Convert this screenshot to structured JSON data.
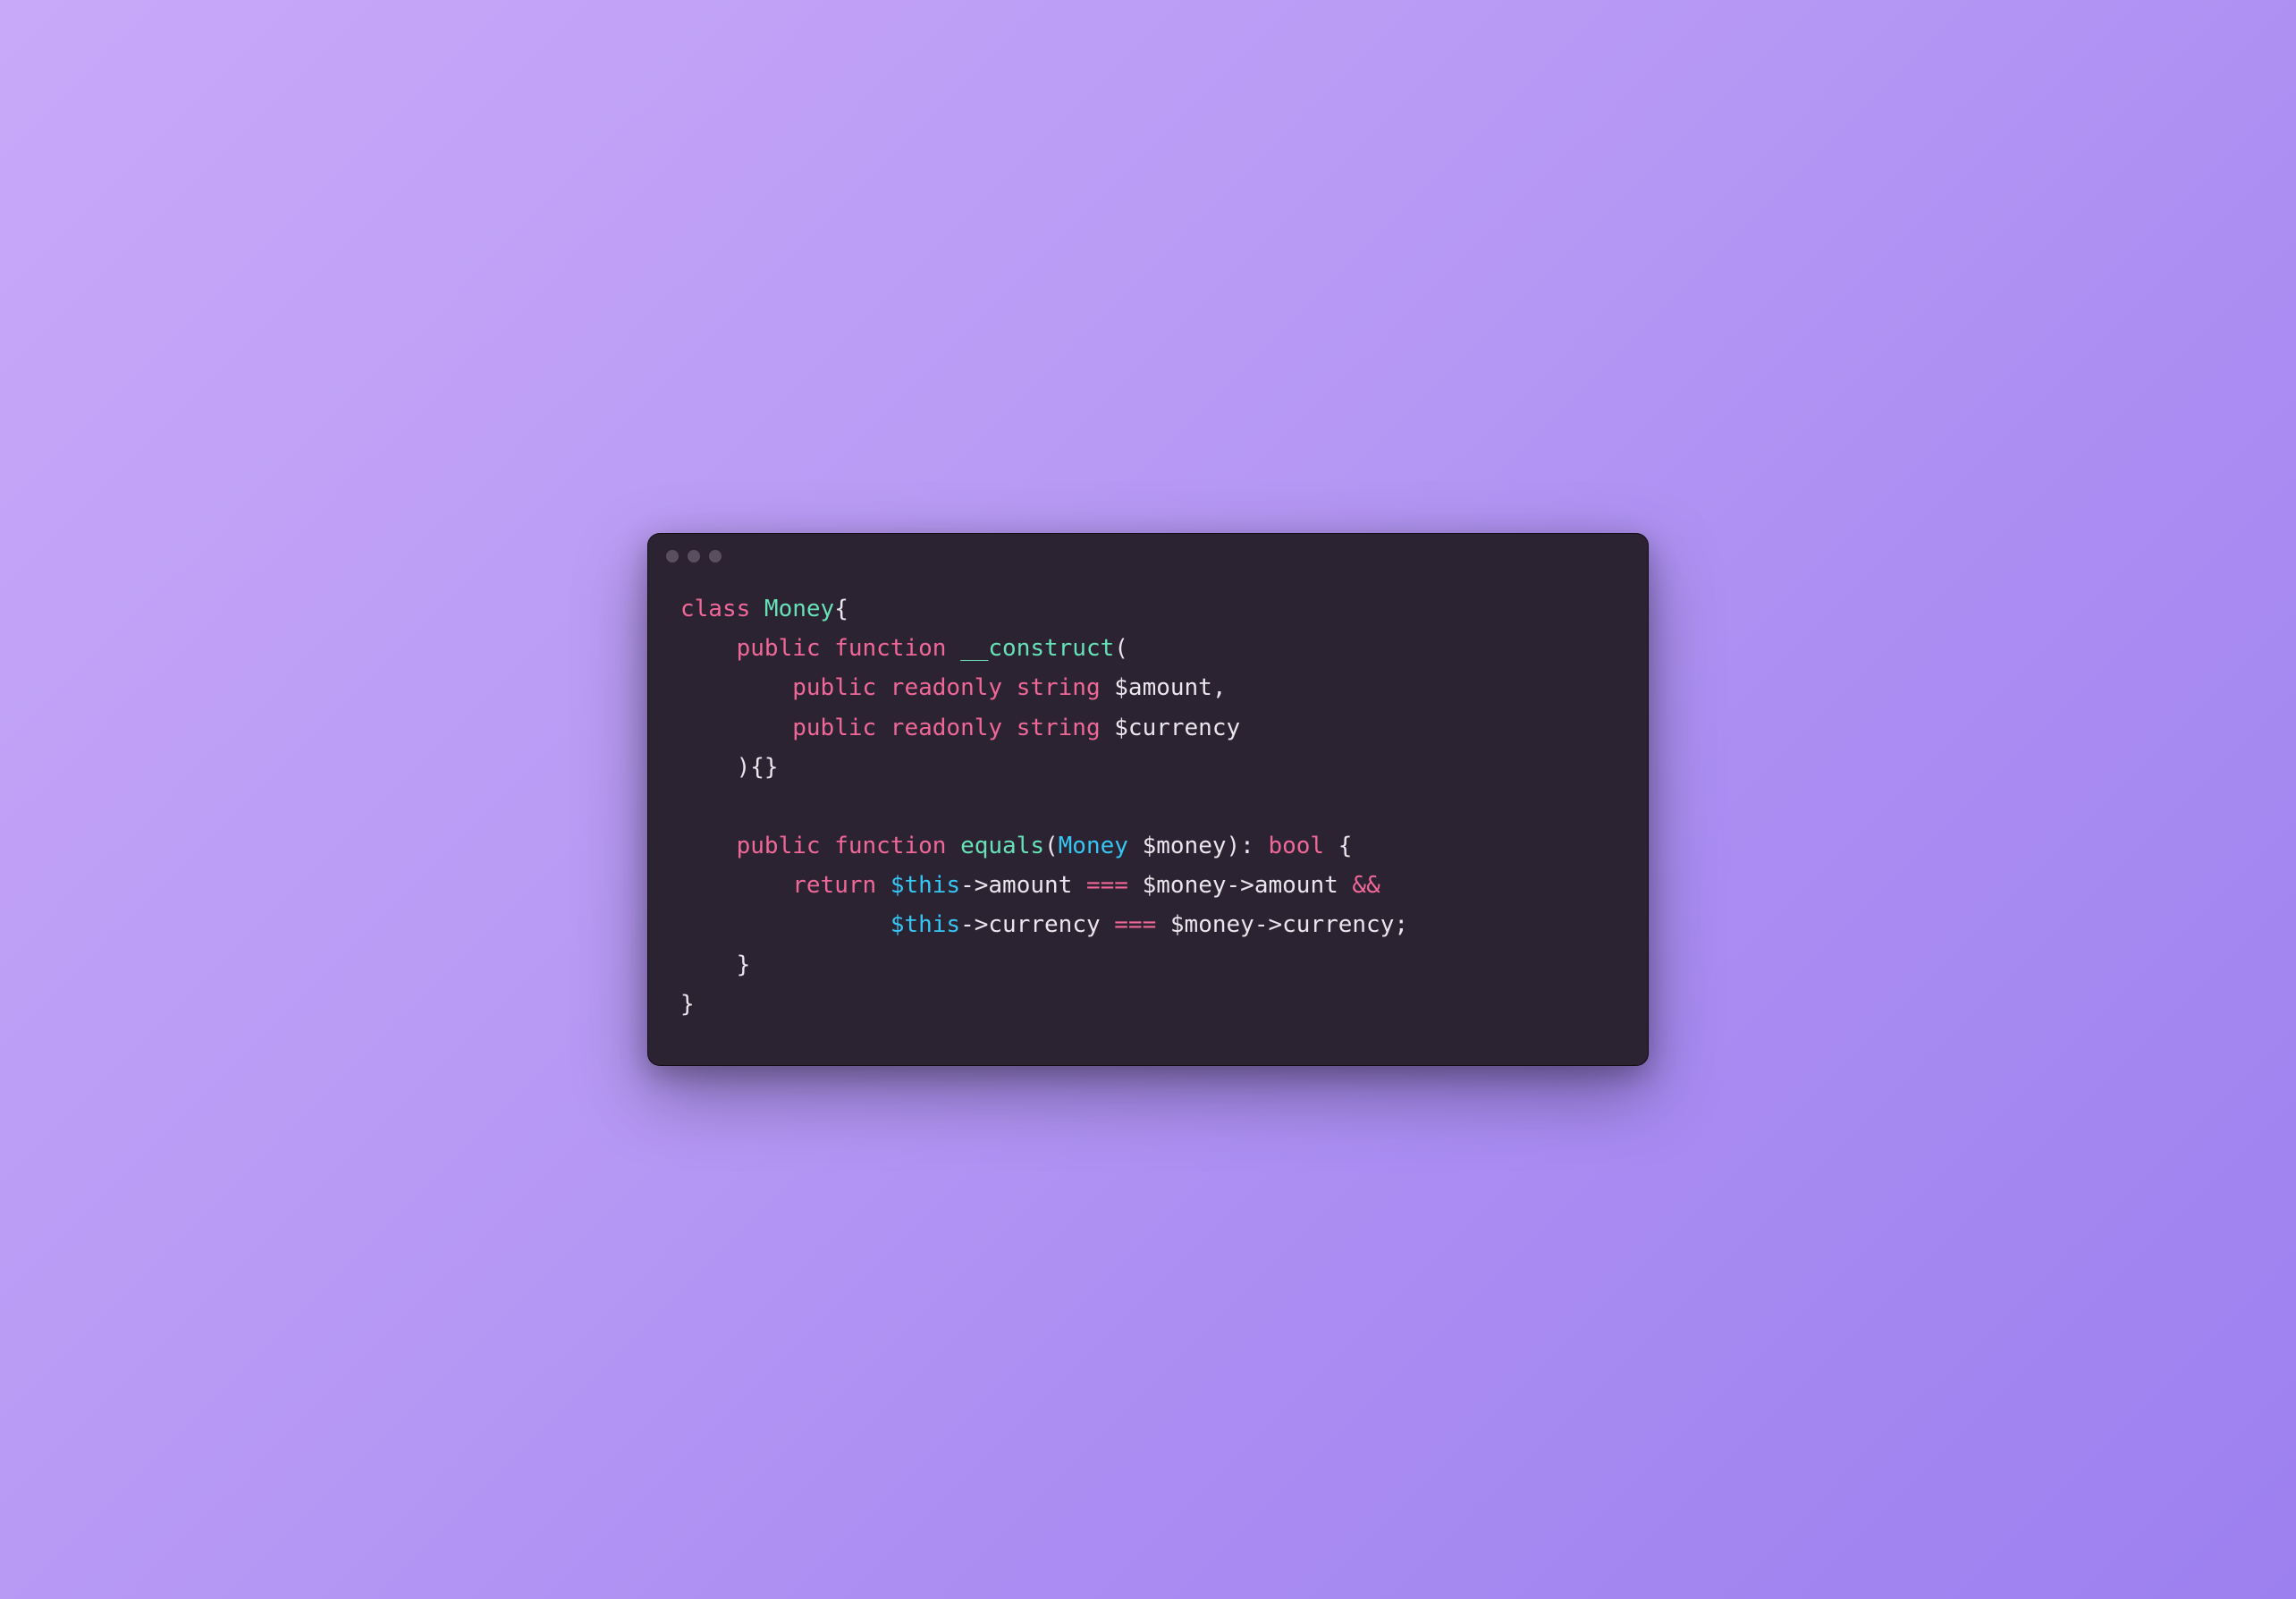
{
  "window": {
    "dots": 3
  },
  "code": {
    "tokens": [
      [
        {
          "t": "class ",
          "c": "tok-keyword"
        },
        {
          "t": "Money",
          "c": "tok-classname"
        },
        {
          "t": "{",
          "c": "tok-punc"
        }
      ],
      [
        {
          "t": "    ",
          "c": "tok-plain"
        },
        {
          "t": "public function ",
          "c": "tok-keyword"
        },
        {
          "t": "__construct",
          "c": "tok-func"
        },
        {
          "t": "(",
          "c": "tok-punc"
        }
      ],
      [
        {
          "t": "        ",
          "c": "tok-plain"
        },
        {
          "t": "public readonly ",
          "c": "tok-keyword"
        },
        {
          "t": "string ",
          "c": "tok-type"
        },
        {
          "t": "$amount",
          "c": "tok-var"
        },
        {
          "t": ",",
          "c": "tok-punc"
        }
      ],
      [
        {
          "t": "        ",
          "c": "tok-plain"
        },
        {
          "t": "public readonly ",
          "c": "tok-keyword"
        },
        {
          "t": "string ",
          "c": "tok-type"
        },
        {
          "t": "$currency",
          "c": "tok-var"
        }
      ],
      [
        {
          "t": "    ){}",
          "c": "tok-punc"
        }
      ],
      [
        {
          "t": "",
          "c": "tok-plain"
        }
      ],
      [
        {
          "t": "    ",
          "c": "tok-plain"
        },
        {
          "t": "public function ",
          "c": "tok-keyword"
        },
        {
          "t": "equals",
          "c": "tok-func"
        },
        {
          "t": "(",
          "c": "tok-punc"
        },
        {
          "t": "Money ",
          "c": "tok-typeref"
        },
        {
          "t": "$money",
          "c": "tok-var"
        },
        {
          "t": "): ",
          "c": "tok-punc"
        },
        {
          "t": "bool",
          "c": "tok-type"
        },
        {
          "t": " {",
          "c": "tok-punc"
        }
      ],
      [
        {
          "t": "        ",
          "c": "tok-plain"
        },
        {
          "t": "return ",
          "c": "tok-keyword"
        },
        {
          "t": "$this",
          "c": "tok-this"
        },
        {
          "t": "->amount ",
          "c": "tok-plain"
        },
        {
          "t": "=== ",
          "c": "tok-op"
        },
        {
          "t": "$money",
          "c": "tok-var"
        },
        {
          "t": "->amount ",
          "c": "tok-plain"
        },
        {
          "t": "&&",
          "c": "tok-op"
        }
      ],
      [
        {
          "t": "               ",
          "c": "tok-plain"
        },
        {
          "t": "$this",
          "c": "tok-this"
        },
        {
          "t": "->currency ",
          "c": "tok-plain"
        },
        {
          "t": "=== ",
          "c": "tok-op"
        },
        {
          "t": "$money",
          "c": "tok-var"
        },
        {
          "t": "->currency;",
          "c": "tok-plain"
        }
      ],
      [
        {
          "t": "    }",
          "c": "tok-punc"
        }
      ],
      [
        {
          "t": "}",
          "c": "tok-punc"
        }
      ]
    ]
  }
}
